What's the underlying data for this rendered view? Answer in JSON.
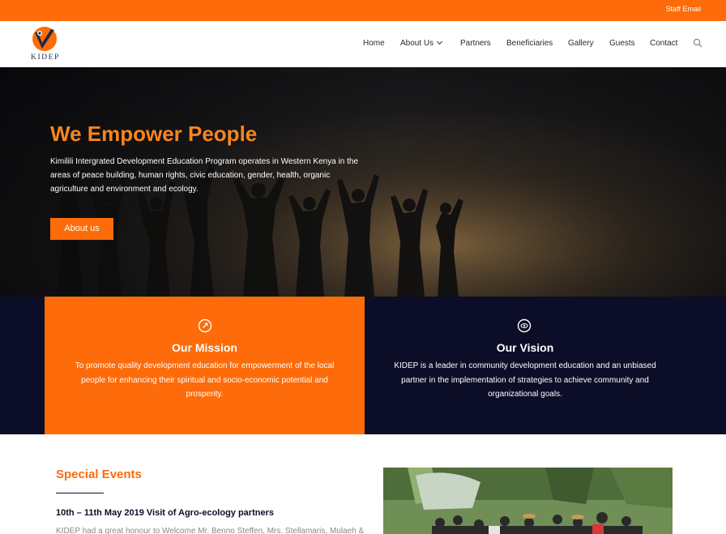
{
  "topbar": {
    "staff_email": "Staff Email",
    "color": "#fd6b0a"
  },
  "brand": {
    "logo_text": "KIDEP"
  },
  "nav": {
    "items": [
      {
        "label": "Home"
      },
      {
        "label": "About Us",
        "has_dropdown": true
      },
      {
        "label": "Partners"
      },
      {
        "label": "Beneficiaries"
      },
      {
        "label": "Gallery"
      },
      {
        "label": "Guests"
      },
      {
        "label": "Contact"
      }
    ],
    "search_icon": "search-icon"
  },
  "hero": {
    "title": "We Empower People",
    "text": "Kimilili Intergrated Development Education Program operates in Western Kenya in the areas of peace building, human rights, civic education, gender, health, organic agriculture and environment and ecology.",
    "button": "About us"
  },
  "mission": {
    "icon": "target-icon",
    "title": "Our Mission",
    "text": "To promote quality development education for empowerment of the local people for enhancing their spiritual and socio-economic potential and prosperity."
  },
  "vision": {
    "icon": "eye-icon",
    "title": "Our Vision",
    "text": "KIDEP is a leader in community development education and an unbiased partner in the implementation of strategies to achieve community and organizational goals."
  },
  "events": {
    "title": "Special Events",
    "event_title": "10th – 11th May 2019 Visit of Agro-ecology partners",
    "event_text": "KIDEP had a great honour to Welcome Mr. Benno Steffen, Mrs. Stellamaris, Mulaeh &"
  },
  "colors": {
    "accent": "#fd6b0a",
    "navy": "#0c0d27",
    "hero_title": "#f5861f"
  }
}
